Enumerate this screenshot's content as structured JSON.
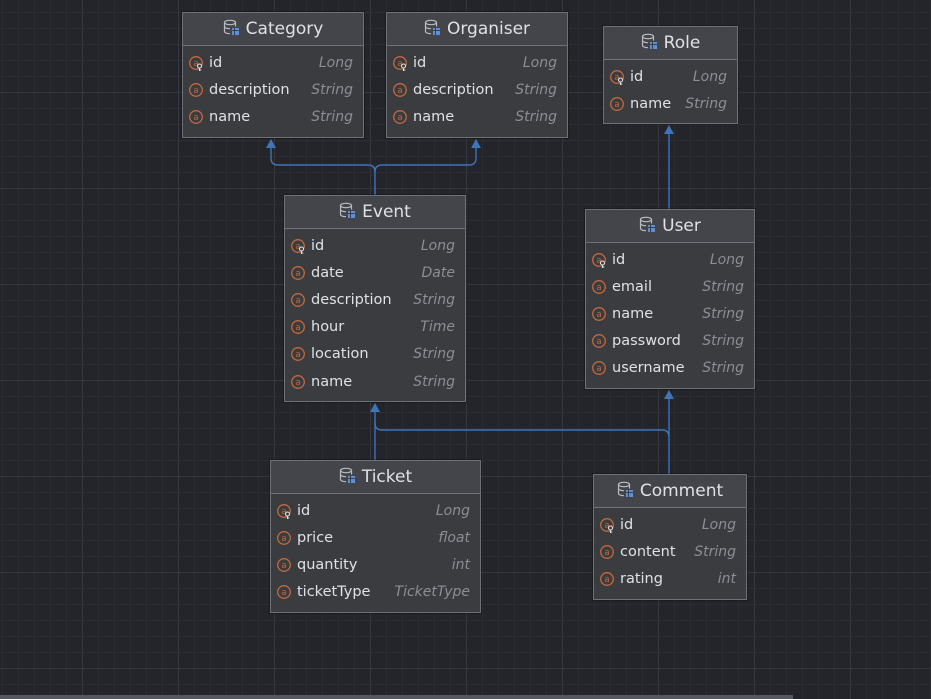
{
  "entities": [
    {
      "key": "category",
      "name": "Category",
      "fields": [
        {
          "name": "id",
          "type": "Long",
          "key": true
        },
        {
          "name": "description",
          "type": "String"
        },
        {
          "name": "name",
          "type": "String"
        }
      ]
    },
    {
      "key": "organiser",
      "name": "Organiser",
      "fields": [
        {
          "name": "id",
          "type": "Long",
          "key": true
        },
        {
          "name": "description",
          "type": "String"
        },
        {
          "name": "name",
          "type": "String"
        }
      ]
    },
    {
      "key": "role",
      "name": "Role",
      "fields": [
        {
          "name": "id",
          "type": "Long",
          "key": true
        },
        {
          "name": "name",
          "type": "String"
        }
      ]
    },
    {
      "key": "event",
      "name": "Event",
      "fields": [
        {
          "name": "id",
          "type": "Long",
          "key": true
        },
        {
          "name": "date",
          "type": "Date"
        },
        {
          "name": "description",
          "type": "String"
        },
        {
          "name": "hour",
          "type": "Time"
        },
        {
          "name": "location",
          "type": "String"
        },
        {
          "name": "name",
          "type": "String"
        }
      ]
    },
    {
      "key": "user",
      "name": "User",
      "fields": [
        {
          "name": "id",
          "type": "Long",
          "key": true
        },
        {
          "name": "email",
          "type": "String"
        },
        {
          "name": "name",
          "type": "String"
        },
        {
          "name": "password",
          "type": "String"
        },
        {
          "name": "username",
          "type": "String"
        }
      ]
    },
    {
      "key": "ticket",
      "name": "Ticket",
      "fields": [
        {
          "name": "id",
          "type": "Long",
          "key": true
        },
        {
          "name": "price",
          "type": "float"
        },
        {
          "name": "quantity",
          "type": "int"
        },
        {
          "name": "ticketType",
          "type": "TicketType"
        }
      ]
    },
    {
      "key": "comment",
      "name": "Comment",
      "fields": [
        {
          "name": "id",
          "type": "Long",
          "key": true
        },
        {
          "name": "content",
          "type": "String"
        },
        {
          "name": "rating",
          "type": "int"
        }
      ]
    }
  ],
  "relations": [
    {
      "from": "event",
      "to": "category"
    },
    {
      "from": "event",
      "to": "organiser"
    },
    {
      "from": "user",
      "to": "role"
    },
    {
      "from": "ticket",
      "to": "event"
    },
    {
      "from": "comment",
      "to": "event"
    },
    {
      "from": "comment",
      "to": "user"
    }
  ],
  "icons": {
    "table": "database-table-icon",
    "key_field": "primary-key-field-icon",
    "field": "field-icon"
  },
  "colors": {
    "connector": "#3e74b8",
    "field_icon": "#c4693c",
    "table_icon": "#5e8fd0"
  }
}
